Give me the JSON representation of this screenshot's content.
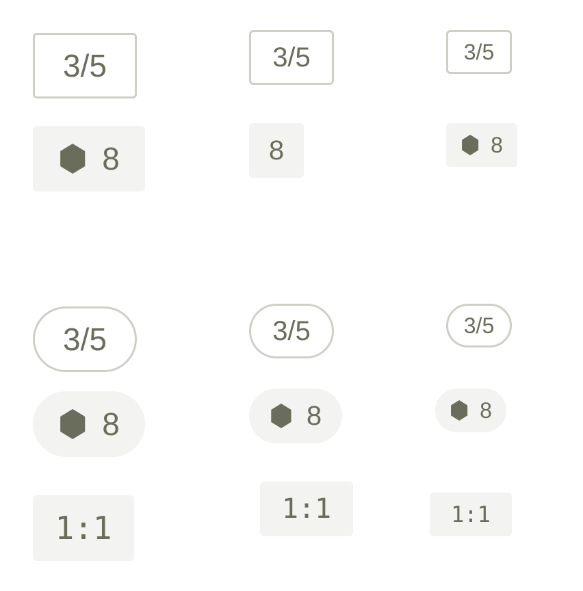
{
  "colors": {
    "text": "#6b6d5c",
    "border": "#cfcfc8",
    "fill": "#f3f3f1"
  },
  "rows": {
    "square": {
      "ratio": {
        "large": "3/5",
        "medium": "3/5",
        "small": "3/5"
      },
      "count": {
        "large": "8",
        "medium": "8",
        "small": "8"
      }
    },
    "rounded": {
      "ratio": {
        "large": "3/5",
        "medium": "3/5",
        "small": "3/5"
      },
      "count": {
        "large": "8",
        "medium": "8",
        "small": "8"
      }
    },
    "aspect": {
      "large": "1:1",
      "medium": "1:1",
      "small": "1:1"
    }
  },
  "icons": {
    "count": "hexagon-icon"
  }
}
